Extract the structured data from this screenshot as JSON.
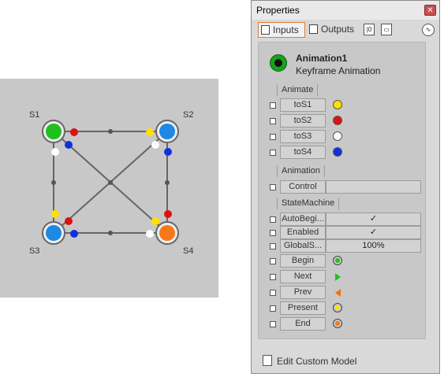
{
  "canvas": {
    "nodes": [
      {
        "id": "S1",
        "label": "S1",
        "color": "#1fbf1f"
      },
      {
        "id": "S2",
        "label": "S2",
        "color": "#1e88e5"
      },
      {
        "id": "S3",
        "label": "S3",
        "color": "#1e88e5"
      },
      {
        "id": "S4",
        "label": "S4",
        "color": "#f5781a"
      }
    ]
  },
  "properties": {
    "title": "Properties",
    "close_icon": "close-icon",
    "tabs": [
      {
        "label": "Inputs",
        "active": true
      },
      {
        "label": "Outputs",
        "active": false
      }
    ],
    "model": {
      "name": "Animation1",
      "type": "Keyframe Animation"
    },
    "sections": {
      "animate": "Animate",
      "animation": "Animation",
      "statemachine": "StateMachine"
    },
    "animate_rows": [
      {
        "label": "toS1",
        "color": "#ffe000"
      },
      {
        "label": "toS2",
        "color": "#e01010"
      },
      {
        "label": "toS3",
        "color": "#ffffff"
      },
      {
        "label": "toS4",
        "color": "#1030e0"
      }
    ],
    "animation_rows": [
      {
        "label": "Control",
        "value": ""
      }
    ],
    "statemachine_rows": [
      {
        "label": "AutoBegi...",
        "value": "✓"
      },
      {
        "label": "Enabled",
        "value": "✓"
      },
      {
        "label": "GlobalS...",
        "value": "100%"
      },
      {
        "label": "Begin",
        "icon": "green-ring",
        "color": "#22c022"
      },
      {
        "label": "Next",
        "icon": "arrow-right",
        "color": "#22c022"
      },
      {
        "label": "Prev",
        "icon": "arrow-left",
        "color": "#f07010"
      },
      {
        "label": "Present",
        "icon": "yellow-ring",
        "color": "#ffe000"
      },
      {
        "label": "End",
        "icon": "orange-ring",
        "color": "#f5781a"
      }
    ],
    "footer": "Edit Custom Model"
  }
}
